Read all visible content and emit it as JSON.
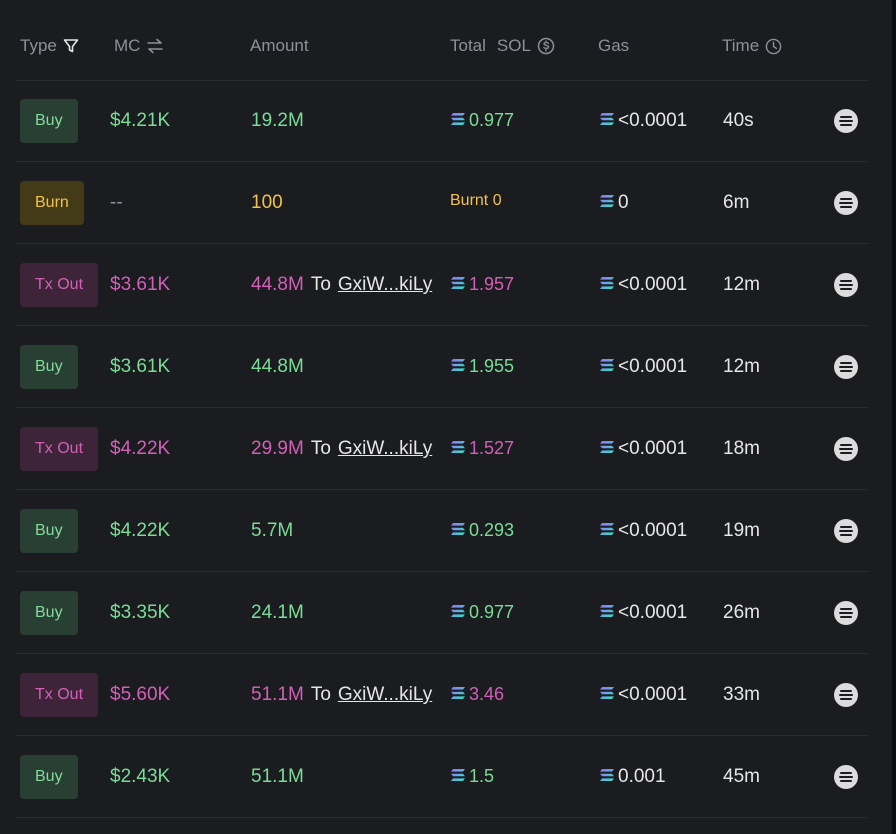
{
  "header": {
    "type": "Type",
    "mc": "MC",
    "amount": "Amount",
    "total": "Total",
    "sol": "SOL",
    "gas": "Gas",
    "time": "Time"
  },
  "rows": [
    {
      "type": "Buy",
      "mc": "$4.21K",
      "amount": "19.2M",
      "to": "",
      "addr": "",
      "total": "0.977",
      "gas": "<0.0001",
      "time": "40s"
    },
    {
      "type": "Burn",
      "mc": "--",
      "amount": "100",
      "to": "",
      "addr": "",
      "total": "Burnt 0",
      "gas": "0",
      "time": "6m"
    },
    {
      "type": "Tx Out",
      "mc": "$3.61K",
      "amount": "44.8M",
      "to": "To",
      "addr": "GxiW...kiLy",
      "total": "1.957",
      "gas": "<0.0001",
      "time": "12m"
    },
    {
      "type": "Buy",
      "mc": "$3.61K",
      "amount": "44.8M",
      "to": "",
      "addr": "",
      "total": "1.955",
      "gas": "<0.0001",
      "time": "12m"
    },
    {
      "type": "Tx Out",
      "mc": "$4.22K",
      "amount": "29.9M",
      "to": "To",
      "addr": "GxiW...kiLy",
      "total": "1.527",
      "gas": "<0.0001",
      "time": "18m"
    },
    {
      "type": "Buy",
      "mc": "$4.22K",
      "amount": "5.7M",
      "to": "",
      "addr": "",
      "total": "0.293",
      "gas": "<0.0001",
      "time": "19m"
    },
    {
      "type": "Buy",
      "mc": "$3.35K",
      "amount": "24.1M",
      "to": "",
      "addr": "",
      "total": "0.977",
      "gas": "<0.0001",
      "time": "26m"
    },
    {
      "type": "Tx Out",
      "mc": "$5.60K",
      "amount": "51.1M",
      "to": "To",
      "addr": "GxiW...kiLy",
      "total": "3.46",
      "gas": "<0.0001",
      "time": "33m"
    },
    {
      "type": "Buy",
      "mc": "$2.43K",
      "amount": "51.1M",
      "to": "",
      "addr": "",
      "total": "1.5",
      "gas": "0.001",
      "time": "45m"
    }
  ],
  "colors": {
    "buy": "#79dd95",
    "burn": "#f2c14e",
    "tx_out": "#d35fb8",
    "background": "#1b1c20"
  },
  "icons": {
    "type_filter": "filter-icon",
    "mc_toggle": "swap-icon",
    "currency_toggle": "currency-icon",
    "time": "clock-icon",
    "solana": "solana-icon",
    "row_action": "menu-icon"
  }
}
